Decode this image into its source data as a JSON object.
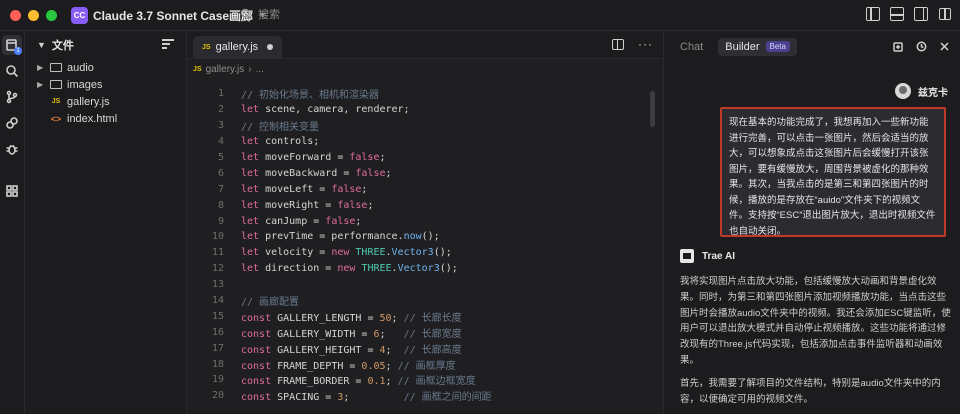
{
  "titlebar": {
    "app_badge": "CC",
    "app_title": "Claude 3.7 Sonnet Case画廊",
    "search_placeholder": "搜索"
  },
  "activity": {
    "explorer_badge": "1"
  },
  "explorer": {
    "title": "文件",
    "items": [
      {
        "label": "audio",
        "type": "folder"
      },
      {
        "label": "images",
        "type": "folder"
      },
      {
        "label": "gallery.js",
        "type": "js"
      },
      {
        "label": "index.html",
        "type": "html"
      }
    ]
  },
  "editor": {
    "tab_label": "gallery.js",
    "file_icon": "JS",
    "breadcrumb_file": "gallery.js",
    "breadcrumb_more": "...",
    "lines": [
      {
        "n": "1",
        "text": "// 初始化场景、相机和渲染器"
      },
      {
        "n": "2",
        "text": "let scene, camera, renderer;"
      },
      {
        "n": "3",
        "text": "// 控制相关变量"
      },
      {
        "n": "4",
        "text": "let controls;"
      },
      {
        "n": "5",
        "text": "let moveForward = false;"
      },
      {
        "n": "6",
        "text": "let moveBackward = false;"
      },
      {
        "n": "7",
        "text": "let moveLeft = false;"
      },
      {
        "n": "8",
        "text": "let moveRight = false;"
      },
      {
        "n": "9",
        "text": "let canJump = false;"
      },
      {
        "n": "10",
        "text": "let prevTime = performance.now();"
      },
      {
        "n": "11",
        "text": "let velocity = new THREE.Vector3();"
      },
      {
        "n": "12",
        "text": "let direction = new THREE.Vector3();"
      },
      {
        "n": "13",
        "text": ""
      },
      {
        "n": "14",
        "text": "// 画廊配置"
      },
      {
        "n": "15",
        "text": "const GALLERY_LENGTH = 50; // 长廊长度"
      },
      {
        "n": "16",
        "text": "const GALLERY_WIDTH = 6;   // 长廊宽度"
      },
      {
        "n": "17",
        "text": "const GALLERY_HEIGHT = 4;  // 长廊高度"
      },
      {
        "n": "18",
        "text": "const FRAME_DEPTH = 0.05; // 画框厚度"
      },
      {
        "n": "19",
        "text": "const FRAME_BORDER = 0.1; // 画框边框宽度"
      },
      {
        "n": "20",
        "text": "const SPACING = 3;         // 画框之间的间距"
      }
    ]
  },
  "panel": {
    "tab_chat": "Chat",
    "tab_builder": "Builder",
    "beta_badge": "Beta",
    "user_name": "兹克卡",
    "user_message": "现在基本的功能完成了，我想再加入一些新功能进行完善，可以点击一张图片，然后会适当的放大，可以想象成点击这张图片后会缓慢打开该张图片，要有缓慢放大，周围背景被虚化的那种效果。其次，当我点击的是第三和第四张图片的时候，播放的是存放在“auido”文件夹下的视频文件。支持按“ESC”退出图片放大，退出时视频文件也自动关闭。",
    "ai_name": "Trae AI",
    "ai_paragraph_1": "我将实现图片点击放大功能，包括缓慢放大动画和背景虚化效果。同时，为第三和第四张图片添加视频播放功能，当点击这些图片时会播放audio文件夹中的视频。我还会添加ESC键监听，使用户可以退出放大模式并自动停止视频播放。这些功能将通过修改现有的Three.js代码实现，包括添加点击事件监听器和动画效果。",
    "ai_paragraph_2": "首先，我需要了解项目的文件结构，特别是audio文件夹中的内容，以便确定可用的视频文件。"
  },
  "colors": {
    "accent": "#4a7dff",
    "highlight_border": "#c0392b",
    "keyword": "#e06c9a",
    "comment": "#6a7a8c",
    "function": "#6fb3f2",
    "number": "#d19a66",
    "class": "#4ec9b0"
  }
}
